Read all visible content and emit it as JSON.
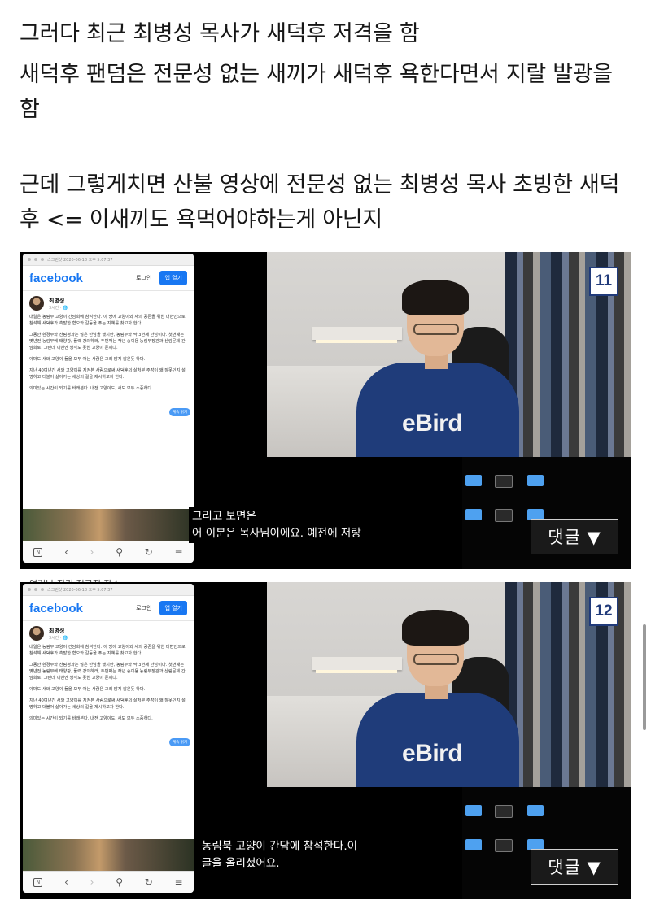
{
  "paragraphs": [
    "그러다 최근 최병성 목사가 새덕후 저격을 함",
    "새덕후 팬덤은 전문성 없는 새끼가 새덕후 욕한다면서 지랄 발광을 함",
    "근데 그렇게치면 산불 영상에 전문성 없는 최병성 목사 초빙한 새덕후 <= 이새끼도 욕먹어야하는게 아닌지"
  ],
  "screenshots": [
    {
      "number": "11",
      "subtitle_lines": [
        "그리고 보면은",
        "어 이분은 목사님이에요. 예전에 저랑"
      ],
      "comment_button": "댓글 ▼"
    },
    {
      "number": "12",
      "subtitle_lines": [
        "농림북 고양이 간담에 참석한다.이",
        "글을 올리셨어요."
      ],
      "comment_button": "댓글 ▼"
    }
  ],
  "facebook_post": {
    "browser_bar": "스크린샷 2020-06-18 오후 5.07.37",
    "logo": "facebook",
    "login": "로그인",
    "open_app": "앱 열기",
    "author": "최병성",
    "author_sub": "3시간 · 🌐",
    "paragraphs": [
      "내일은 농림부 고양이 간담회에 참석한다. 이 땅에 고양이와 새의 공존을 위한 대변인으로 참석해 새덕후가 촉발한 혐오와 갈등을 푸는 지혜를 찾고자 한다.",
      "그동안 환경부와 산림청과는 많은 만남을 했지만, 농림부와 딱 3번째 만남이다. 첫번째는 몇년전 농림부에 태양광, 풀력 강의하러, 두번째는 작년 송이용 농림부장관과 산림문제 간담회로. 그런데 이번엔 생각도 못한 고양이 문제다.",
      "아마도 새와 고양이 둘을 모두 아는 사람은 그리 많지 않은듯 하다.",
      "지난 40여년간 새와 고양이를 지켜본 사람으로써 새덕후의 살처분 주장이 왜 잘못인지 설명하고 더불어 살아가는 세상의 길을 제시하고자 한다.",
      "의미있는 시간이 되기를 바래본다. 내전 고양이도, 새도 모두 소중하다."
    ],
    "chip": "계속 읽기"
  },
  "shirt_text": "eBird",
  "cut_caption": "여러나 지기 저그저 자스"
}
